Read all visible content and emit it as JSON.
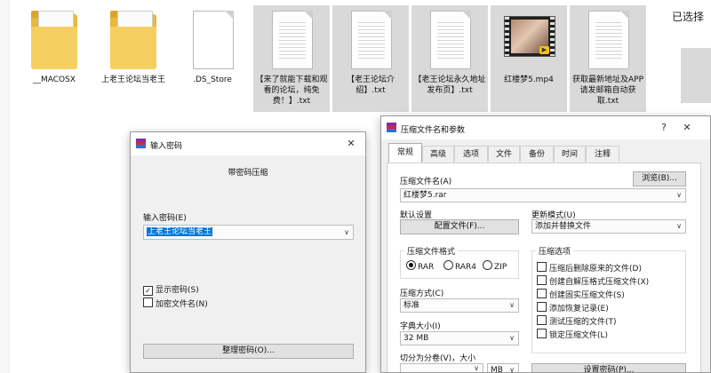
{
  "files": [
    {
      "name": "__MACOSX",
      "type": "folder"
    },
    {
      "name": "上老王论坛当老王",
      "type": "folder"
    },
    {
      "name": ".DS_Store",
      "type": "file"
    },
    {
      "name": "【来了就能下载和观看的论坛，纯免费！】.txt",
      "type": "text"
    },
    {
      "name": "【老王论坛介绍】.txt",
      "type": "text"
    },
    {
      "name": "【老王论坛永久地址发布页】.txt",
      "type": "text"
    },
    {
      "name": "红楼梦5.mp4",
      "type": "video"
    },
    {
      "name": "获取最新地址及APP请发邮箱自动获取.txt",
      "type": "text"
    }
  ],
  "right_panel": {
    "title": "已选择"
  },
  "password_dialog": {
    "title": "输入密码",
    "subtitle": "带密码压缩",
    "input_label": "输入密码(E)",
    "input_value": "上老王论坛当老王",
    "show_password": {
      "label": "显示密码(S)",
      "checked": true
    },
    "encrypt_names": {
      "label": "加密文件名(N)",
      "checked": false
    },
    "manage_button": "整理密码(O)..."
  },
  "archive_dialog": {
    "title": "压缩文件名和参数",
    "help": "?",
    "tabs": [
      "常规",
      "高级",
      "选项",
      "文件",
      "备份",
      "时间",
      "注释"
    ],
    "active_tab": "常规",
    "archive_name_label": "压缩文件名(A)",
    "browse_button": "浏览(B)...",
    "archive_name_value": "红楼梦5.rar",
    "default_settings_label": "默认设置",
    "profiles_button": "配置文件(F)...",
    "update_mode_label": "更新模式(U)",
    "update_mode_value": "添加并替换文件",
    "format_group": "压缩文件格式",
    "formats": [
      "RAR",
      "RAR4",
      "ZIP"
    ],
    "format_selected": "RAR",
    "method_label": "压缩方式(C)",
    "method_value": "标准",
    "dict_label": "字典大小(I)",
    "dict_value": "32 MB",
    "split_label": "切分为分卷(V)，大小",
    "split_unit": "MB",
    "options_group": "压缩选项",
    "options": [
      {
        "label": "压缩后删除原来的文件(D)",
        "checked": false
      },
      {
        "label": "创建自解压格式压缩文件(X)",
        "checked": false
      },
      {
        "label": "创建固实压缩文件(S)",
        "checked": false
      },
      {
        "label": "添加恢复记录(E)",
        "checked": false
      },
      {
        "label": "测试压缩的文件(T)",
        "checked": false
      },
      {
        "label": "锁定压缩文件(L)",
        "checked": false
      }
    ],
    "set_password_button": "设置密码(P)..."
  },
  "icons": {
    "close": "close-icon",
    "dropdown": "chevron-down-icon",
    "winrar": "winrar-icon"
  },
  "colors": {
    "folder": "#f6cf62",
    "selection": "#d9d9d9",
    "input_highlight": "#0078d7"
  }
}
